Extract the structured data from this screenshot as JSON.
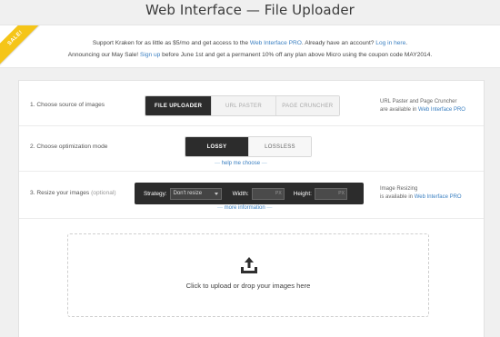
{
  "page": {
    "title": "Web Interface — File Uploader"
  },
  "promo": {
    "sale_badge": "SALE!",
    "line1_pre": "Support Kraken for as little as $5/mo and get access to the ",
    "line1_link1": "Web Interface PRO",
    "line1_mid": ". Already have an account? ",
    "line1_link2": "Log in here",
    "line1_post": ".",
    "line2_pre": "Announcing our May Sale! ",
    "line2_link": "Sign up",
    "line2_post": " before June 1st and get a permanent 10% off any plan above Micro using the coupon code MAY2014."
  },
  "source": {
    "label": "1. Choose source of images",
    "options": [
      "FILE UPLOADER",
      "URL PASTER",
      "PAGE CRUNCHER"
    ],
    "active_index": 0,
    "note_line1": "URL Paster and Page Cruncher",
    "note_line2_pre": "are available in ",
    "note_line2_link": "Web Interface PRO"
  },
  "optimization": {
    "label": "2. Choose optimization mode",
    "options": [
      "LOSSY",
      "LOSSLESS"
    ],
    "active_index": 0,
    "help_link": "help me choose"
  },
  "resize": {
    "label": "3. Resize your images",
    "label_optional": "(optional)",
    "strategy_label": "Strategy:",
    "strategy_value": "Don't resize",
    "width_label": "Width:",
    "width_unit": "PX",
    "height_label": "Height:",
    "height_unit": "PX",
    "more_link": "more information",
    "note_line1": "Image Resizing",
    "note_line2_pre": "is available in ",
    "note_line2_link": "Web Interface PRO"
  },
  "dropzone": {
    "text": "Click to upload or drop your images here",
    "icon": "upload-tray-icon"
  },
  "colors": {
    "accent": "#3a7fc1",
    "sale": "#f5c518",
    "active_button": "#2c2c2c"
  }
}
